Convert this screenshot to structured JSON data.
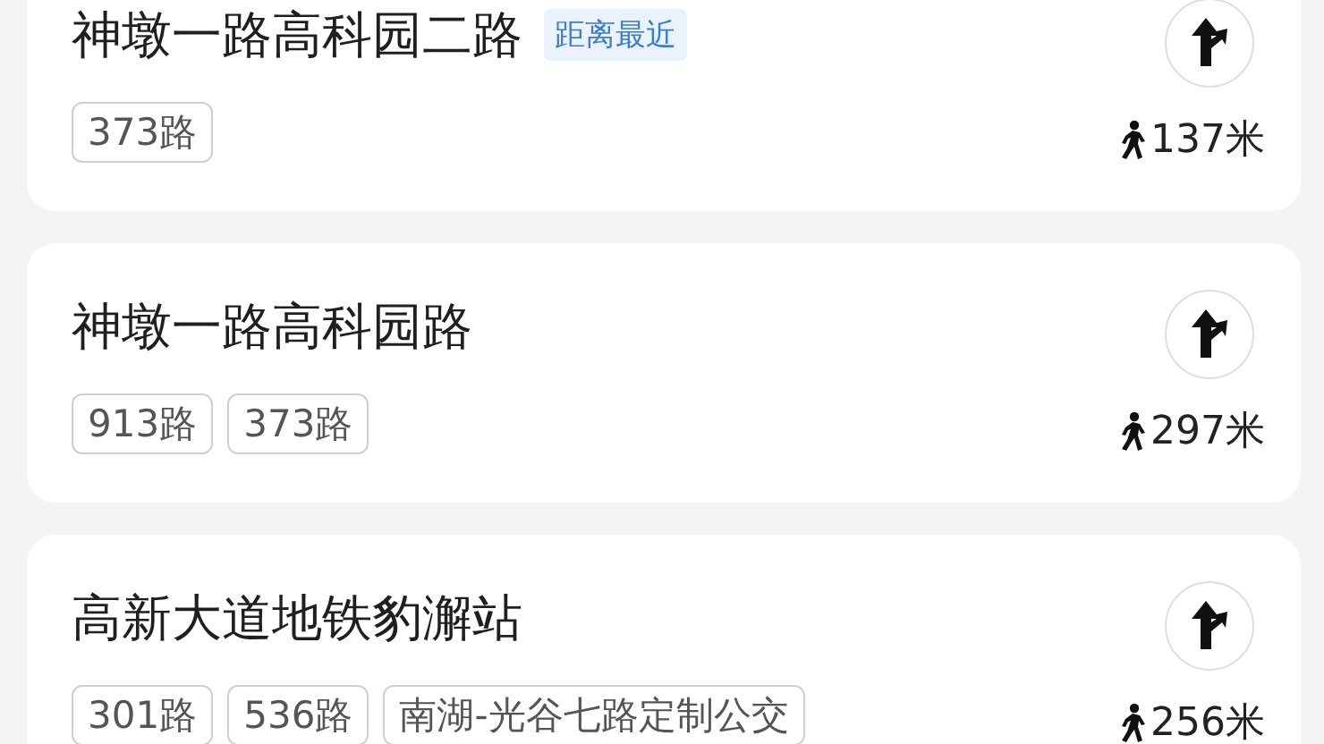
{
  "stops": [
    {
      "name": "神墩一路高科园二路",
      "badge": "距离最近",
      "routes": [
        "373路"
      ],
      "distance": "137米"
    },
    {
      "name": "神墩一路高科园路",
      "routes": [
        "913路",
        "373路"
      ],
      "distance": "297米"
    },
    {
      "name": "高新大道地铁豹澥站",
      "routes": [
        "301路",
        "536路",
        "南湖-光谷七路定制公交"
      ],
      "distance": "256米"
    }
  ]
}
